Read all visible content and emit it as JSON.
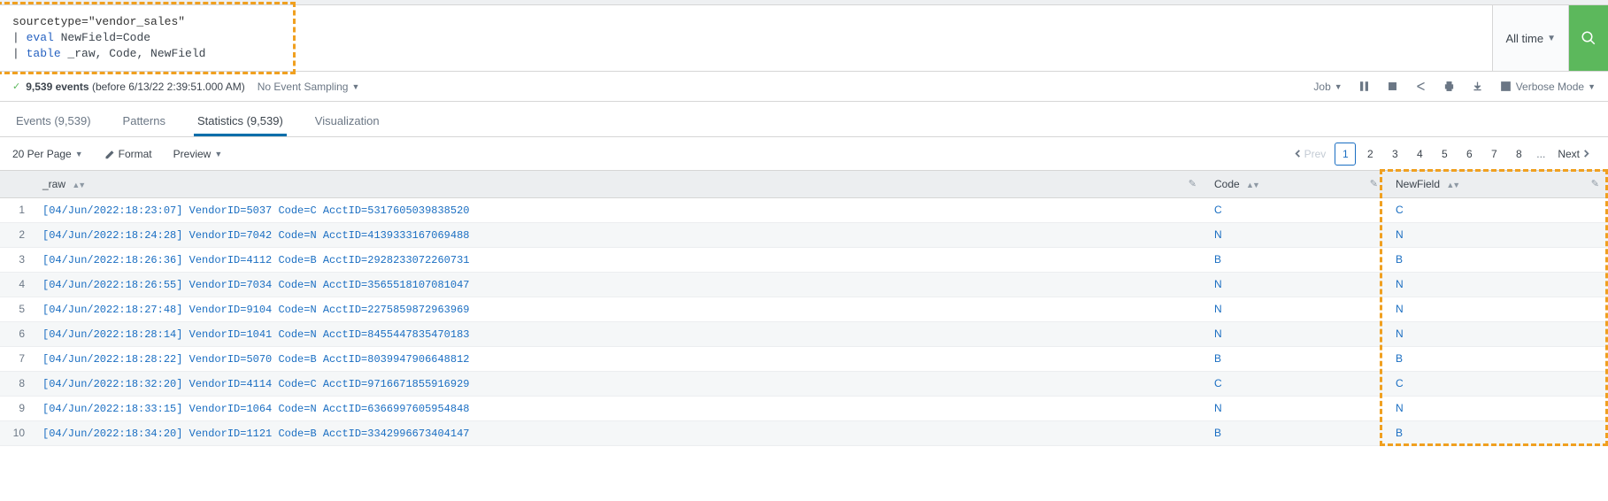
{
  "search": {
    "line1_prefix": "sourcetype=",
    "line1_value": "\"vendor_sales\"",
    "line2_cmd": "eval",
    "line2_rest": " NewField=Code",
    "line3_cmd": "table",
    "line3_rest": " _raw, Code, NewField"
  },
  "time_picker": "All time",
  "status": {
    "count": "9,539 events",
    "timestamp": "(before 6/13/22 2:39:51.000 AM)",
    "sampling": "No Event Sampling",
    "job": "Job",
    "mode": "Verbose Mode"
  },
  "tabs": [
    {
      "label": "Events (9,539)",
      "active": false
    },
    {
      "label": "Patterns",
      "active": false
    },
    {
      "label": "Statistics (9,539)",
      "active": true
    },
    {
      "label": "Visualization",
      "active": false
    }
  ],
  "toolbar": {
    "per_page": "20 Per Page",
    "format": "Format",
    "preview": "Preview"
  },
  "pager": {
    "prev": "Prev",
    "pages": [
      "1",
      "2",
      "3",
      "4",
      "5",
      "6",
      "7",
      "8"
    ],
    "current": "1",
    "next": "Next"
  },
  "columns": {
    "raw": "_raw",
    "code": "Code",
    "newfield": "NewField"
  },
  "rows": [
    {
      "idx": "1",
      "raw": "[04/Jun/2022:18:23:07] VendorID=5037 Code=C AcctID=5317605039838520",
      "code": "C",
      "newfield": "C"
    },
    {
      "idx": "2",
      "raw": "[04/Jun/2022:18:24:28] VendorID=7042 Code=N AcctID=4139333167069488",
      "code": "N",
      "newfield": "N"
    },
    {
      "idx": "3",
      "raw": "[04/Jun/2022:18:26:36] VendorID=4112 Code=B AcctID=2928233072260731",
      "code": "B",
      "newfield": "B"
    },
    {
      "idx": "4",
      "raw": "[04/Jun/2022:18:26:55] VendorID=7034 Code=N AcctID=3565518107081047",
      "code": "N",
      "newfield": "N"
    },
    {
      "idx": "5",
      "raw": "[04/Jun/2022:18:27:48] VendorID=9104 Code=N AcctID=2275859872963969",
      "code": "N",
      "newfield": "N"
    },
    {
      "idx": "6",
      "raw": "[04/Jun/2022:18:28:14] VendorID=1041 Code=N AcctID=8455447835470183",
      "code": "N",
      "newfield": "N"
    },
    {
      "idx": "7",
      "raw": "[04/Jun/2022:18:28:22] VendorID=5070 Code=B AcctID=8039947906648812",
      "code": "B",
      "newfield": "B"
    },
    {
      "idx": "8",
      "raw": "[04/Jun/2022:18:32:20] VendorID=4114 Code=C AcctID=9716671855916929",
      "code": "C",
      "newfield": "C"
    },
    {
      "idx": "9",
      "raw": "[04/Jun/2022:18:33:15] VendorID=1064 Code=N AcctID=6366997605954848",
      "code": "N",
      "newfield": "N"
    },
    {
      "idx": "10",
      "raw": "[04/Jun/2022:18:34:20] VendorID=1121 Code=B AcctID=3342996673404147",
      "code": "B",
      "newfield": "B"
    }
  ]
}
